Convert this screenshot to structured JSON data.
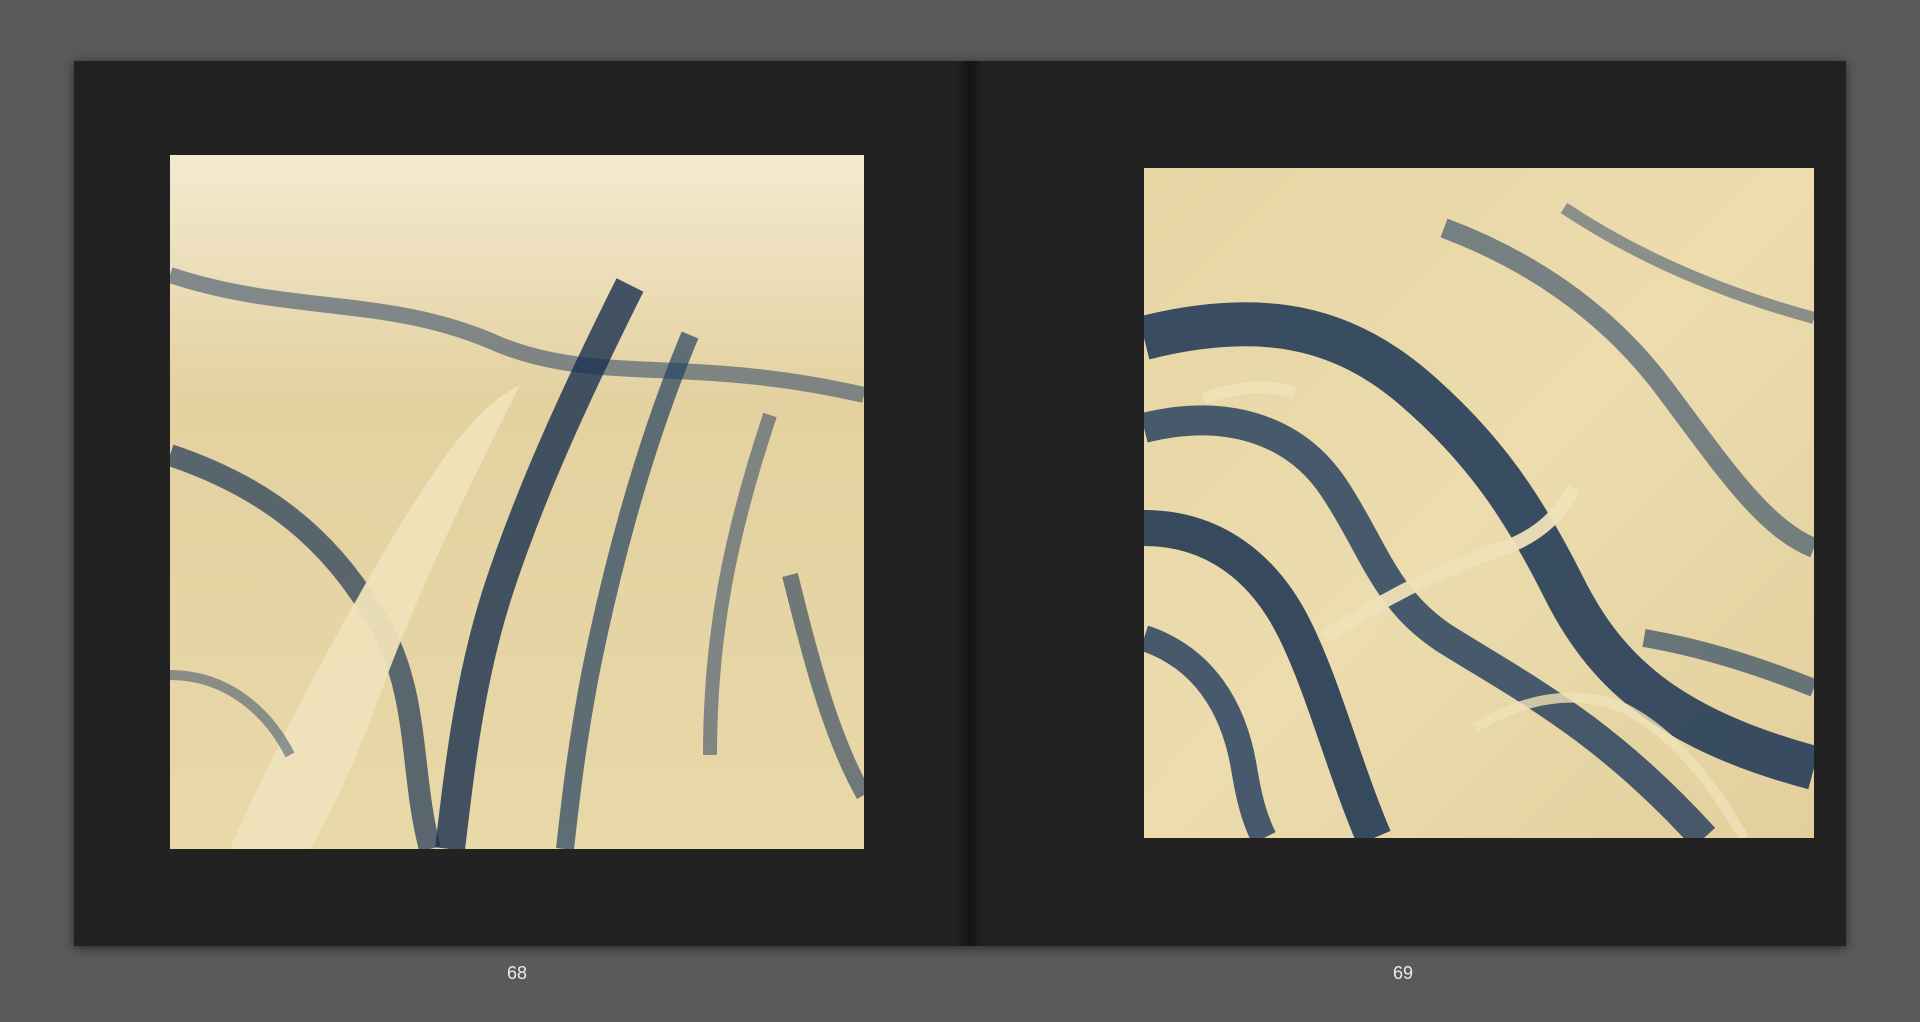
{
  "book": {
    "pages": [
      {
        "number": "68",
        "photo": {
          "icon": "aerial-landscape-photo",
          "tones": [
            "#e8d9a8",
            "#1f3a5c"
          ]
        }
      },
      {
        "number": "69",
        "photo": {
          "icon": "aerial-landscape-photo",
          "tones": [
            "#e8d9a8",
            "#1f3a5c"
          ]
        }
      }
    ]
  },
  "colors": {
    "background": "#5a5a5a",
    "spread": "#232223",
    "page_number": "#ececec"
  }
}
